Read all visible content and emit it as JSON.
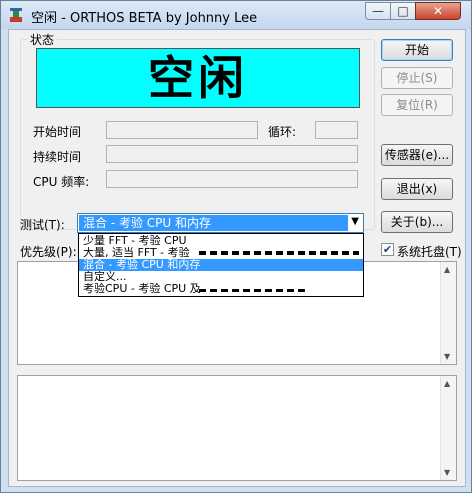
{
  "window": {
    "title": "空闲 - ORTHOS BETA by Johnny Lee",
    "minimize_glyph": "—",
    "maximize_glyph": "□",
    "close_glyph": "✕",
    "icon": "orthos-app-icon"
  },
  "status_group": {
    "label": "状态",
    "status_text": "空闲",
    "status_color": "#00ffff"
  },
  "fields": {
    "start_time_label": "开始时间",
    "loop_label": "循环:",
    "duration_label": "持续时间",
    "cpu_freq_label": "CPU 频率:"
  },
  "buttons": {
    "start": "开始",
    "stop": "停止(S)",
    "reset": "复位(R)",
    "sensors": "传感器(e)...",
    "exit": "退出(x)",
    "about": "关于(b)..."
  },
  "test": {
    "label": "测试(T):",
    "selected": "混合 - 考验 CPU 和内存",
    "options": [
      "少量 FFT - 考验 CPU",
      "大量, 适当 FFT - 考验",
      "混合 - 考验 CPU 和内存",
      "自定义...",
      "考验CPU - 考验 CPU 及"
    ]
  },
  "priority": {
    "label": "优先级(P):"
  },
  "tray": {
    "label": "系统托盘(T)",
    "checked": true,
    "check_glyph": "✔"
  },
  "scroll": {
    "up_glyph": "▲",
    "down_glyph": "▼"
  }
}
